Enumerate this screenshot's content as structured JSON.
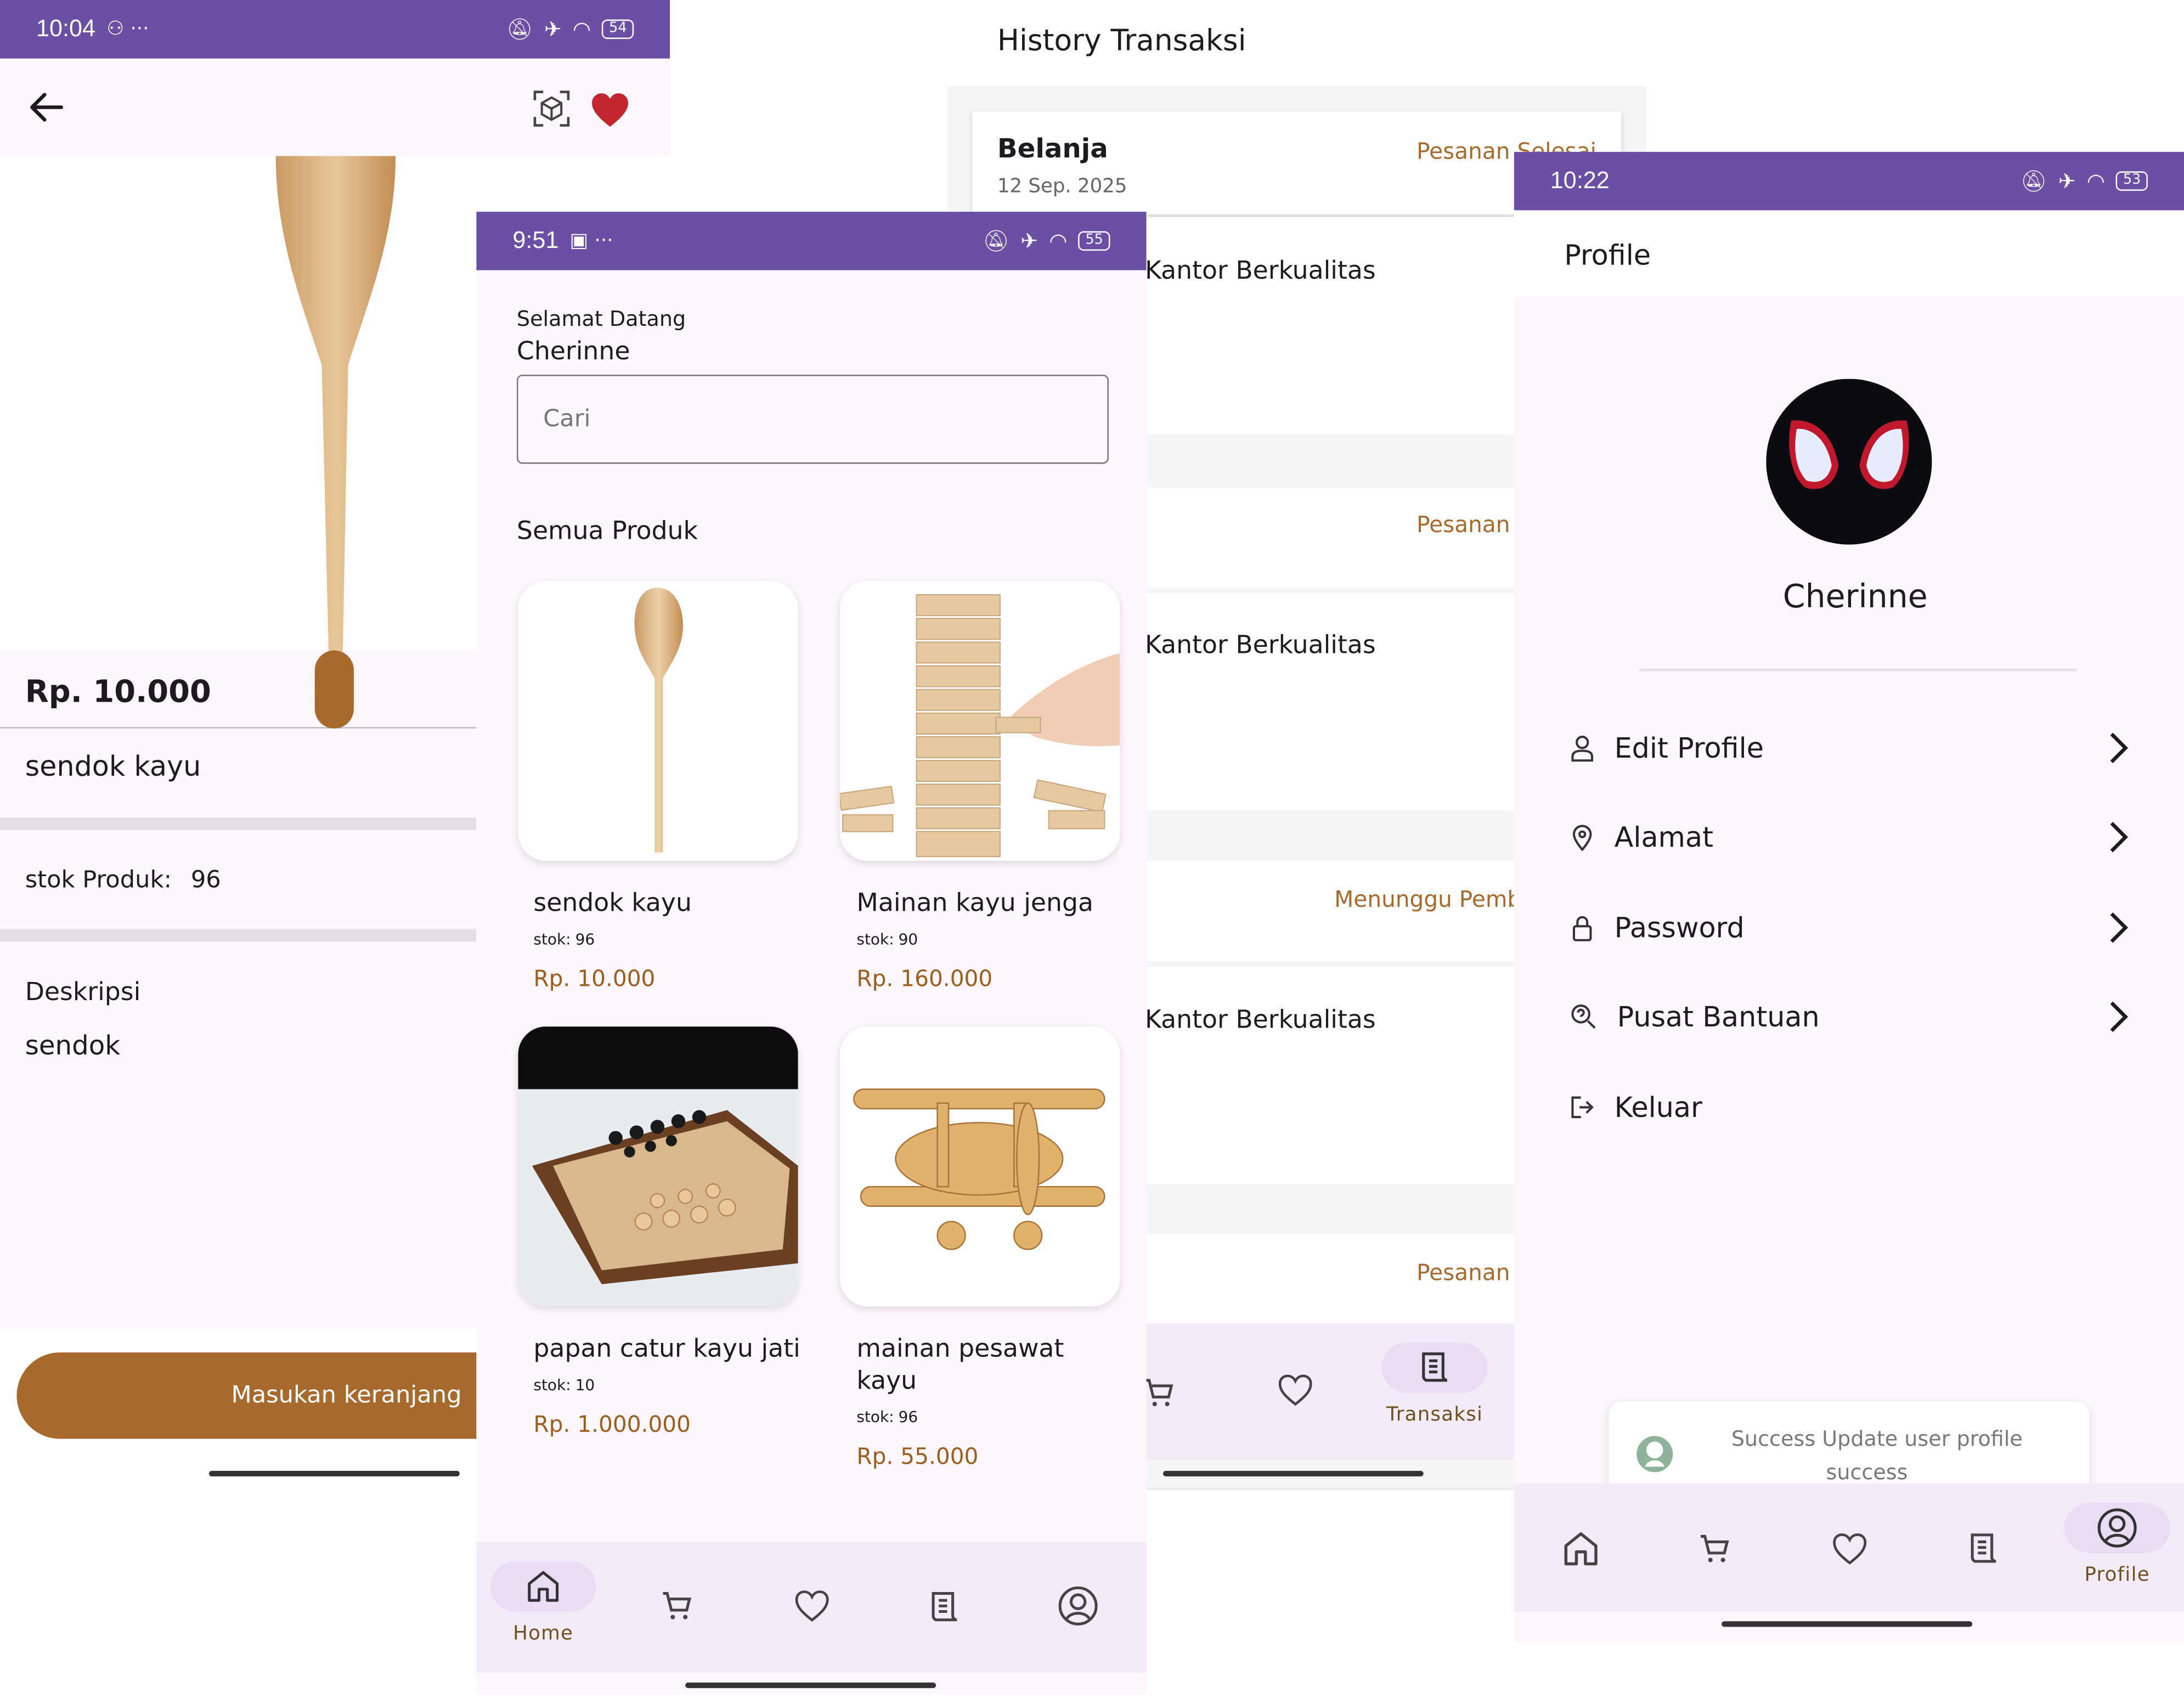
{
  "detail": {
    "status": {
      "time": "10:04",
      "battery": "54"
    },
    "price": "Rp. 10.000",
    "name": "sendok kayu",
    "stock_label": "stok Produk:",
    "stock_value": "96",
    "desc_label": "Deskripsi",
    "desc_value": "sendok",
    "add_to_cart": "Masukan keranjang"
  },
  "history": {
    "title": "History Transaksi",
    "first": {
      "title": "Belanja",
      "date": "12 Sep. 2025",
      "status": "Pesanan Selesai"
    },
    "items": [
      {
        "store": "Kantor Berkualitas"
      },
      {
        "status": "Pesanan S",
        "store": "Kantor Berkualitas"
      },
      {
        "status": "Menunggu Pemb",
        "store": "Kantor Berkualitas"
      },
      {
        "status": "Pesanan S"
      }
    ],
    "nav_active_label": "Transaksi"
  },
  "home": {
    "status": {
      "time": "9:51",
      "battery": "55"
    },
    "greeting": "Selamat Datang",
    "username": "Cherinne",
    "search_placeholder": "Cari",
    "section_title": "Semua Produk",
    "stock_prefix": "stok:",
    "products": [
      {
        "name": "sendok kayu",
        "stock": "96",
        "price": "Rp. 10.000"
      },
      {
        "name": "Mainan kayu jenga",
        "stock": "90",
        "price": "Rp. 160.000"
      },
      {
        "name": "papan catur kayu jati",
        "stock": "10",
        "price": "Rp. 1.000.000"
      },
      {
        "name": "mainan pesawat",
        "name2": "kayu",
        "stock": "96",
        "price": "Rp. 55.000"
      }
    ],
    "nav_active_label": "Home"
  },
  "profile": {
    "status": {
      "time": "10:22",
      "battery": "53"
    },
    "title": "Profile",
    "username": "Cherinne",
    "menu": [
      {
        "label": "Edit Profile"
      },
      {
        "label": "Alamat"
      },
      {
        "label": "Password"
      },
      {
        "label": "Pusat Bantuan"
      },
      {
        "label": "Keluar"
      }
    ],
    "toast_line1": "Success Update user profile",
    "toast_line2": "success",
    "nav_active_label": "Profile"
  },
  "colors": {
    "statusbar": "#6a4fa4",
    "brown": "#a86a2c",
    "page_bg": "#fef7fd",
    "nav_bg": "#f3ecf8",
    "pill": "#e9ddf6"
  }
}
